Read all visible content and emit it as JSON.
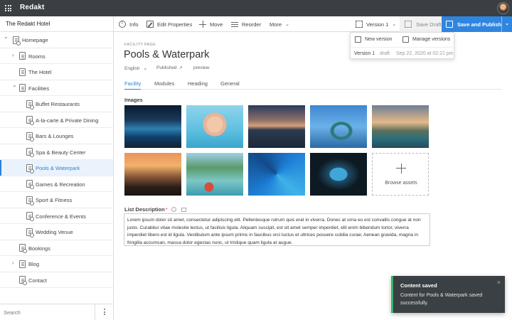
{
  "app": {
    "brand": "Redakt"
  },
  "sidebar": {
    "site_title": "The Redakt Hotel",
    "items": [
      {
        "label": "Homepage",
        "icon": "home-page-icon",
        "expanded": true
      },
      {
        "label": "Rooms",
        "icon": "page-icon",
        "expanded": false
      },
      {
        "label": "The Hotel",
        "icon": "page-icon"
      },
      {
        "label": "Facilities",
        "icon": "page-icon",
        "expanded": true
      },
      {
        "label": "Buffet Restaurants",
        "icon": "facility-page-icon"
      },
      {
        "label": "A-la-carte & Private Dining",
        "icon": "facility-page-icon"
      },
      {
        "label": "Bars & Lounges",
        "icon": "facility-page-icon"
      },
      {
        "label": "Spa & Beauty Center",
        "icon": "facility-page-icon"
      },
      {
        "label": "Pools & Waterpark",
        "icon": "facility-page-icon",
        "selected": true
      },
      {
        "label": "Games & Recreation",
        "icon": "facility-page-icon"
      },
      {
        "label": "Sport & Fitness",
        "icon": "facility-page-icon"
      },
      {
        "label": "Conference & Events",
        "icon": "facility-page-icon"
      },
      {
        "label": "Wedding Venue",
        "icon": "facility-page-icon"
      },
      {
        "label": "Bookings",
        "icon": "search-page-icon"
      },
      {
        "label": "Blog",
        "icon": "page-icon",
        "expanded": false
      },
      {
        "label": "Contact",
        "icon": "search-page-icon"
      }
    ],
    "search_placeholder": "Search"
  },
  "toolbar": {
    "info": "Info",
    "edit_properties": "Edit Properties",
    "move": "Move",
    "reorder": "Reorder",
    "more": "More",
    "version": "Version 1",
    "save_draft": "Save Draft",
    "save_publish": "Save and Publish"
  },
  "version_menu": {
    "new_version": "New version",
    "manage_versions": "Manage versions",
    "row": {
      "version": "Version 1",
      "status": "draft",
      "date": "Sep 22, 2020 at 02:21 pm"
    }
  },
  "page": {
    "type_label": "FACILITY PAGE",
    "title": "Pools & Waterpark",
    "language": "English",
    "status": "Published",
    "preview": "preview",
    "tabs": [
      "Facility",
      "Modules",
      "Heading",
      "General"
    ],
    "active_tab": "Facility",
    "images_label": "Images",
    "images": [
      "pool-night-photo",
      "child-in-pool-photo",
      "resort-sunset-photo",
      "waterslide-photo",
      "beach-resort-photo",
      "palm-sunset-photo",
      "waterpark-photo",
      "aerial-pool-photo",
      "night-pool-aerial-photo"
    ],
    "browse_assets": "Browse assets",
    "list_description_label": "List Description",
    "list_description_required": "*",
    "list_description": "Lorem ipsum dolor sit amet, consectetur adipiscing elit. Pellentesque rutrum quis erat in viverra. Donec at urna eu est convallis congue at non justo. Curabitur vitae molestie lectus, ut facilisis ligula. Aliquam suscipit, est sit amet semper imperdiet, elit enim bibendum tortor, viverra imperdiet libero est id ligula. Vestibulum ante ipsum primis in faucibus orci luctus et ultrices posuere cubilia curae; Aenean gravida, magna in fringilla accumsan, massa dolor egestas nunc, ut tristique quam ligula at augue."
  },
  "toast": {
    "title": "Content saved",
    "message": "Content for Pools & Waterpark saved successfully."
  },
  "colors": {
    "accent": "#2f86e0",
    "topbar": "#3b3e43",
    "success": "#35b36b"
  }
}
